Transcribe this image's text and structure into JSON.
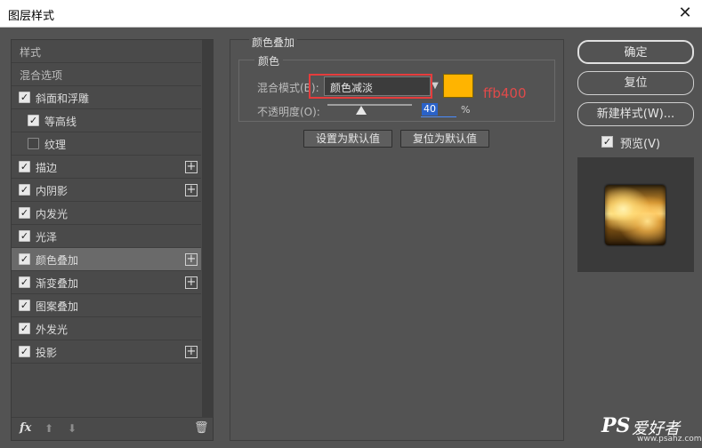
{
  "window": {
    "title": "图层样式",
    "close_glyph": "✕"
  },
  "left": {
    "items": [
      {
        "label": "样式",
        "header": true
      },
      {
        "label": "混合选项",
        "header": true
      },
      {
        "label": "斜面和浮雕",
        "checked": true,
        "indent": 0,
        "plus": false
      },
      {
        "label": "等高线",
        "checked": true,
        "indent": 1,
        "plus": false
      },
      {
        "label": "纹理",
        "checked": false,
        "indent": 1,
        "plus": false
      },
      {
        "label": "描边",
        "checked": true,
        "indent": 0,
        "plus": true
      },
      {
        "label": "内阴影",
        "checked": true,
        "indent": 0,
        "plus": true
      },
      {
        "label": "内发光",
        "checked": true,
        "indent": 0,
        "plus": false
      },
      {
        "label": "光泽",
        "checked": true,
        "indent": 0,
        "plus": false
      },
      {
        "label": "颜色叠加",
        "checked": true,
        "indent": 0,
        "plus": true,
        "selected": true
      },
      {
        "label": "渐变叠加",
        "checked": true,
        "indent": 0,
        "plus": true
      },
      {
        "label": "图案叠加",
        "checked": true,
        "indent": 0,
        "plus": false
      },
      {
        "label": "外发光",
        "checked": true,
        "indent": 0,
        "plus": false
      },
      {
        "label": "投影",
        "checked": true,
        "indent": 0,
        "plus": true
      }
    ],
    "bottom": {
      "fx": "fx",
      "up": "⬆",
      "down": "⬇",
      "trash": "🗑"
    }
  },
  "panel": {
    "section_title": "颜色叠加",
    "group_title": "颜色",
    "blend_mode_label": "混合模式(B):",
    "blend_mode_value": "颜色减淡",
    "color_hex": "#ffb400",
    "color_note": "ffb400",
    "opacity_label": "不透明度(O):",
    "opacity_value": "40",
    "opacity_fraction": 0.4,
    "opacity_unit": "%",
    "default_button": "设置为默认值",
    "reset_button": "复位为默认值"
  },
  "right": {
    "ok": "确定",
    "reset": "复位",
    "new_style": "新建样式(W)...",
    "preview_label": "预览(V)",
    "preview_checked": true
  },
  "watermark": {
    "ps": "PS",
    "cn": "爱好者",
    "url": "www.psahz.com"
  }
}
